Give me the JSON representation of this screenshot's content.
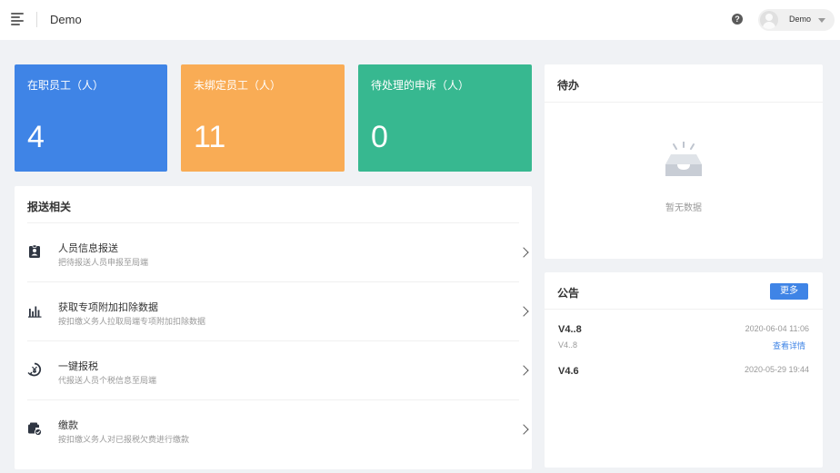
{
  "header": {
    "title": "Demo",
    "user_name": "Demo"
  },
  "stats": [
    {
      "label": "在职员工（人）",
      "value": "4",
      "color": "#3f84e6"
    },
    {
      "label": "未绑定员工（人）",
      "value": "11",
      "color": "#f9ac55"
    },
    {
      "label": "待处理的申诉（人）",
      "value": "0",
      "color": "#37b890"
    }
  ],
  "report": {
    "title": "报送相关",
    "items": [
      {
        "title": "人员信息报送",
        "desc": "把待报送人员申报至局端",
        "icon": "id-badge-icon"
      },
      {
        "title": "获取专项附加扣除数据",
        "desc": "按扣缴义务人拉取局端专项附加扣除数据",
        "icon": "bar-chart-icon"
      },
      {
        "title": "一键报税",
        "desc": "代报送人员个税信息至局端",
        "icon": "tax-report-icon"
      },
      {
        "title": "缴款",
        "desc": "按扣缴义务人对已报税欠费进行缴款",
        "icon": "payment-icon"
      }
    ]
  },
  "todo": {
    "title": "待办",
    "empty_text": "暂无数据"
  },
  "notice": {
    "title": "公告",
    "more_label": "更多",
    "items": [
      {
        "version": "V4..8",
        "date": "2020-06-04 11:06",
        "sub": "V4..8",
        "link": "查看详情"
      },
      {
        "version": "V4.6",
        "date": "2020-05-29 19:44"
      }
    ]
  },
  "colors": {
    "accent": "#3f84e6",
    "background": "#f0f2f5"
  }
}
